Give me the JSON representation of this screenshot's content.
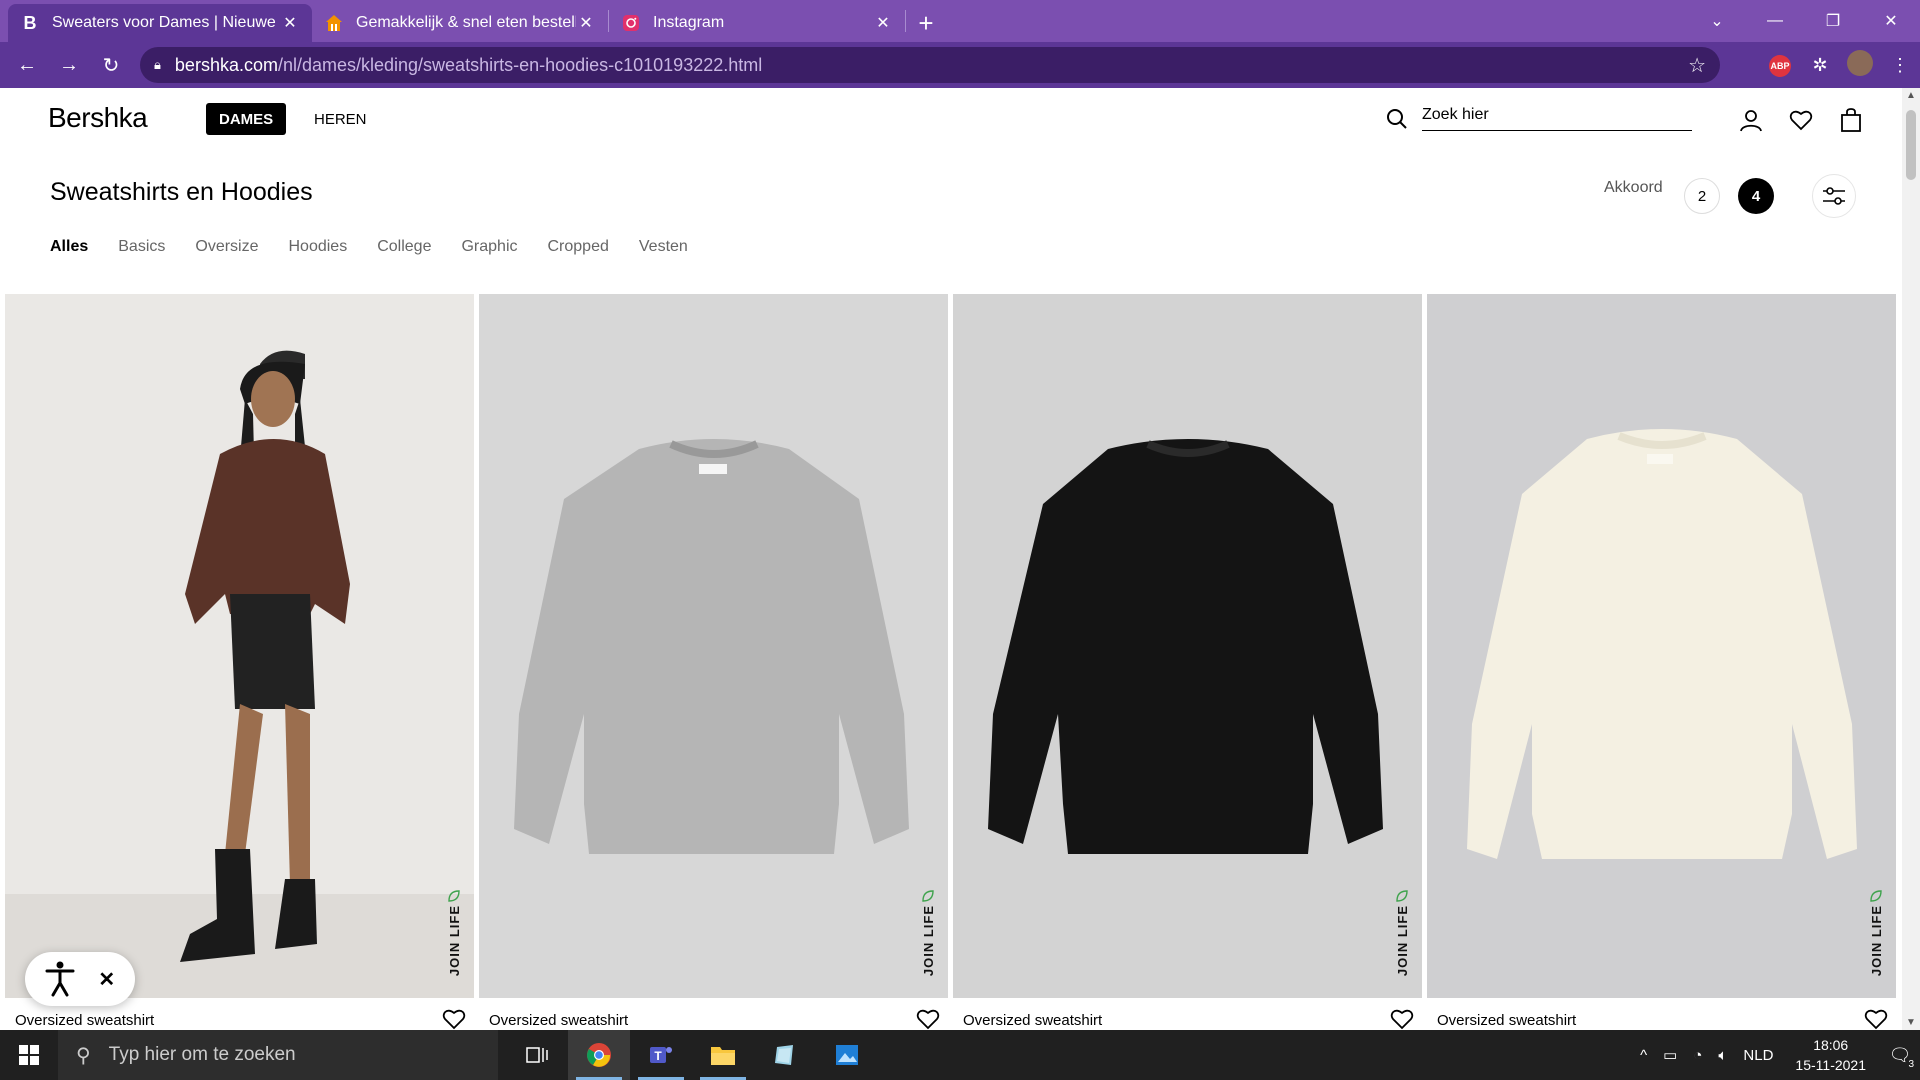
{
  "browser": {
    "tabs": [
      {
        "title": "Sweaters voor Dames | Nieuwe C",
        "favicon": "B",
        "active": true
      },
      {
        "title": "Gemakkelijk & snel eten bestelle",
        "favicon": "takeaway-icon",
        "active": false
      },
      {
        "title": "Instagram",
        "favicon": "instagram-icon",
        "active": false
      }
    ],
    "url_host": "bershka.com",
    "url_path": "/nl/dames/kleding/sweatshirts-en-hoodies-c1010193222.html",
    "abp_count": "1"
  },
  "header": {
    "logo": "Bershka",
    "gender_tabs": [
      "DAMES",
      "HEREN"
    ],
    "search_placeholder": "Zoek hier"
  },
  "category": {
    "title": "Sweatshirts en Hoodies",
    "sort_label": "Akkoord",
    "grid_options": [
      "2",
      "4"
    ],
    "subcategories": [
      "Alles",
      "Basics",
      "Oversize",
      "Hoodies",
      "College",
      "Graphic",
      "Cropped",
      "Vesten"
    ]
  },
  "products": [
    {
      "name": "Oversized sweatshirt",
      "badge": "JOIN LIFE",
      "color": "#5a3328",
      "bg": "#e8e6e3"
    },
    {
      "name": "Oversized sweatshirt",
      "badge": "JOIN LIFE",
      "color": "#b4b4b4",
      "bg": "#d6d6d6"
    },
    {
      "name": "Oversized sweatshirt",
      "badge": "JOIN LIFE",
      "color": "#121212",
      "bg": "#d3d3d3"
    },
    {
      "name": "Oversized sweatshirt",
      "badge": "JOIN LIFE",
      "color": "#f3efe0",
      "bg": "#cfcfd1"
    }
  ],
  "taskbar": {
    "search_placeholder": "Typ hier om te zoeken",
    "language": "NLD",
    "time": "18:06",
    "date": "15-11-2021",
    "notifications": "3"
  }
}
